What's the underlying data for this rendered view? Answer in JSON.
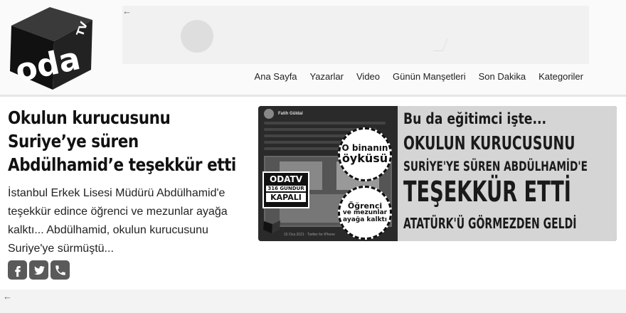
{
  "header": {
    "logo_text": "oda",
    "logo_tv": "TV",
    "back_arrow": "←"
  },
  "nav": {
    "items": [
      {
        "label": "Ana Sayfa"
      },
      {
        "label": "Yazarlar"
      },
      {
        "label": "Video"
      },
      {
        "label": "Günün Manşetleri"
      },
      {
        "label": "Son Dakika"
      },
      {
        "label": "Kategoriler"
      }
    ]
  },
  "article": {
    "title": "Okulun kurucusunu Suriye’ye süren Abdülhamid’e teşekkür etti",
    "description": "İstanbul Erkek Lisesi Müdürü Abdülhamid'e teşekkür edince öğrenci ve mezunlar ayağa kalktı... Abdülhamid, okulun kurucusunu Suriye'ye sürmüştü...",
    "share_icons": [
      "facebook-icon",
      "twitter-icon",
      "phone-icon"
    ]
  },
  "image": {
    "tweet_author": "Fatih Güldal",
    "tweet_footer": "15 Oca 2021 · Twitter for iPhone",
    "badge1_line1": "O binanın",
    "badge1_line2": "öyküsü",
    "badge2_line1": "Öğrenci",
    "badge2_line2": "ve mezunlar",
    "badge2_line3": "ayağa kalktı",
    "odatv_tag_1": "ODATV",
    "odatv_tag_2": "316 GÜNDÜR",
    "odatv_tag_3": "KAPALI",
    "headline_1": "Bu da eğitimci işte...",
    "headline_2": "OKULUN KURUCUSUNU",
    "headline_3": "SURİYE'YE SÜREN ABDÜLHAMİD'E",
    "headline_4": "TEŞEKKÜR ETTİ",
    "headline_5": "ATATÜRK'Ü GÖRMEZDEN GELDİ"
  },
  "bottom": {
    "back_arrow": "←"
  }
}
